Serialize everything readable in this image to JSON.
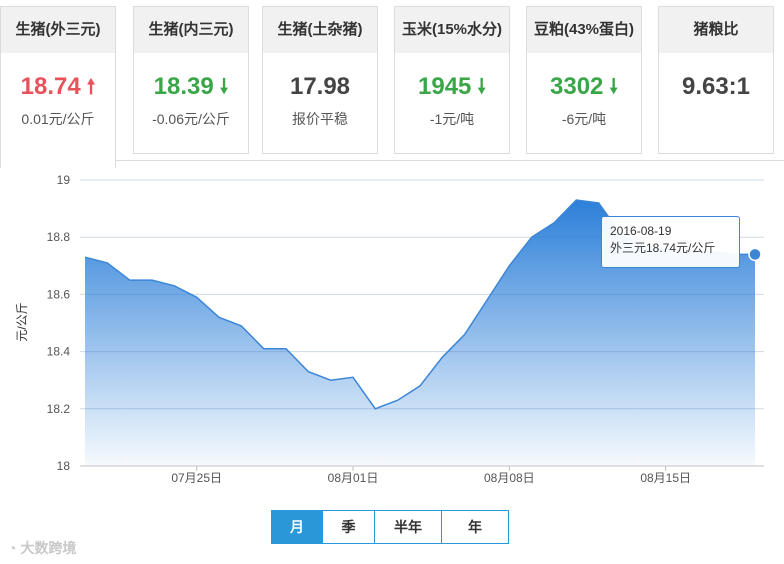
{
  "cards": [
    {
      "title": "生猪(外三元)",
      "price": "18.74",
      "trend": "up",
      "delta": "0.01元/公斤"
    },
    {
      "title": "生猪(内三元)",
      "price": "18.39",
      "trend": "down",
      "delta": "-0.06元/公斤"
    },
    {
      "title": "生猪(土杂猪)",
      "price": "17.98",
      "trend": "flat",
      "delta": "报价平稳"
    },
    {
      "title": "玉米(15%水分)",
      "price": "1945",
      "trend": "down",
      "delta": "-1元/吨"
    },
    {
      "title": "豆粕(43%蛋白)",
      "price": "3302",
      "trend": "down",
      "delta": "-6元/吨"
    },
    {
      "title": "猪粮比",
      "price": "9.63:1",
      "trend": "none",
      "delta": ""
    }
  ],
  "chart_data": {
    "type": "area",
    "ylabel": "元/公斤",
    "ylim": [
      18,
      19
    ],
    "yticks": [
      18,
      18.2,
      18.4,
      18.6,
      18.8,
      19
    ],
    "ytick_labels": [
      "18",
      "18.2",
      "18.4",
      "18.6",
      "18.8",
      "19"
    ],
    "x_dates": [
      "2016-07-20",
      "2016-07-21",
      "2016-07-22",
      "2016-07-23",
      "2016-07-24",
      "2016-07-25",
      "2016-07-26",
      "2016-07-27",
      "2016-07-28",
      "2016-07-29",
      "2016-07-30",
      "2016-07-31",
      "2016-08-01",
      "2016-08-02",
      "2016-08-03",
      "2016-08-04",
      "2016-08-05",
      "2016-08-06",
      "2016-08-07",
      "2016-08-08",
      "2016-08-09",
      "2016-08-10",
      "2016-08-11",
      "2016-08-12",
      "2016-08-13",
      "2016-08-14",
      "2016-08-15",
      "2016-08-16",
      "2016-08-17",
      "2016-08-18",
      "2016-08-19"
    ],
    "values": [
      18.73,
      18.71,
      18.65,
      18.65,
      18.63,
      18.59,
      18.52,
      18.49,
      18.41,
      18.41,
      18.33,
      18.3,
      18.31,
      18.2,
      18.23,
      18.28,
      18.38,
      18.46,
      18.58,
      18.7,
      18.8,
      18.85,
      18.93,
      18.92,
      18.81,
      18.77,
      18.76,
      18.75,
      18.75,
      18.74,
      18.74
    ],
    "xticks": [
      "07月25日",
      "08月01日",
      "08月08日",
      "08月15日"
    ],
    "xtick_indices": [
      5,
      12,
      19,
      26
    ],
    "color": "#3c86d6",
    "grid": true,
    "tooltip": {
      "date": "2016-08-19",
      "text": "外三元18.74元/公斤"
    }
  },
  "range_buttons": [
    "月",
    "季",
    "半年",
    "年"
  ],
  "watermark": "大数跨境"
}
